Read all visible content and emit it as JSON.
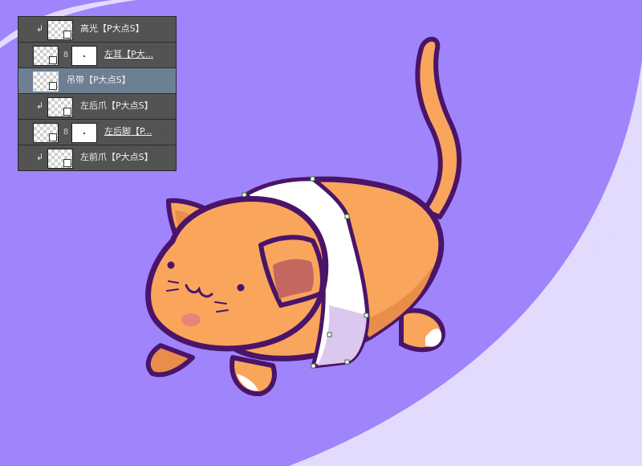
{
  "layers_panel": {
    "layers": [
      {
        "name": "高光【P大点S】",
        "clipped": true,
        "has_mask": false,
        "selected": false,
        "underlined": false
      },
      {
        "name": "左耳【P大...",
        "clipped": false,
        "has_mask": true,
        "selected": false,
        "underlined": true
      },
      {
        "name": "吊带【P大点S】",
        "clipped": false,
        "has_mask": false,
        "selected": true,
        "underlined": false
      },
      {
        "name": "左后爪【P大点S】",
        "clipped": true,
        "has_mask": false,
        "selected": false,
        "underlined": false
      },
      {
        "name": "左后脚【P...",
        "clipped": false,
        "has_mask": true,
        "selected": false,
        "underlined": true
      },
      {
        "name": "左前爪【P大点S】",
        "clipped": true,
        "has_mask": false,
        "selected": false,
        "underlined": false
      }
    ]
  },
  "colors": {
    "background": "#a084fb",
    "background_light": "#e2dbfd",
    "cat_body": "#f9a55c",
    "cat_shadow": "#e88d4a",
    "outline": "#4a1468",
    "strap": "#ffffff",
    "strap_shadow": "#dcc7ef",
    "blush": "#e8837a",
    "selected_layer": "#6d7f93",
    "panel": "#535353"
  },
  "icons": [
    "clip-arrow-icon",
    "layer-thumbnail-icon",
    "link-chain-icon",
    "layer-mask-icon"
  ]
}
